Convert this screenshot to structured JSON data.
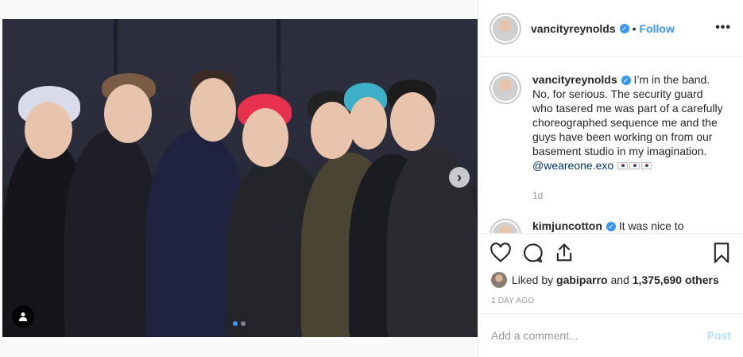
{
  "header": {
    "username": "vancityreynolds",
    "separator": "•",
    "follow_label": "Follow",
    "more_label": "•••"
  },
  "photo": {
    "slide_count": 2,
    "active_slide": 1
  },
  "comments": [
    {
      "username": "vancityreynolds",
      "text": "I’m in the band. No, for serious. The security guard who tasered me was part of a carefully choreographed sequence me and the guys have been working on from our basement studio in my imagination. ",
      "mention": "@weareone.exo",
      "age": "1d"
    },
    {
      "username": "kimjuncotton",
      "text": "It was nice to"
    }
  ],
  "likes": {
    "prefix": "Liked by",
    "user": "gabiparro",
    "and": "and",
    "count": "1,375,690 others"
  },
  "date": "1 DAY AGO",
  "add_comment": {
    "placeholder": "Add a comment...",
    "post_label": "Post"
  },
  "colors": {
    "accent": "#3897f0",
    "text": "#262626",
    "muted": "#999999",
    "post_disabled": "#b2dffc",
    "border": "#efefef"
  },
  "icons": [
    "heart-icon",
    "comment-icon",
    "share-icon",
    "bookmark-icon",
    "user-tag-icon",
    "verified-icon",
    "chevron-right-icon"
  ]
}
